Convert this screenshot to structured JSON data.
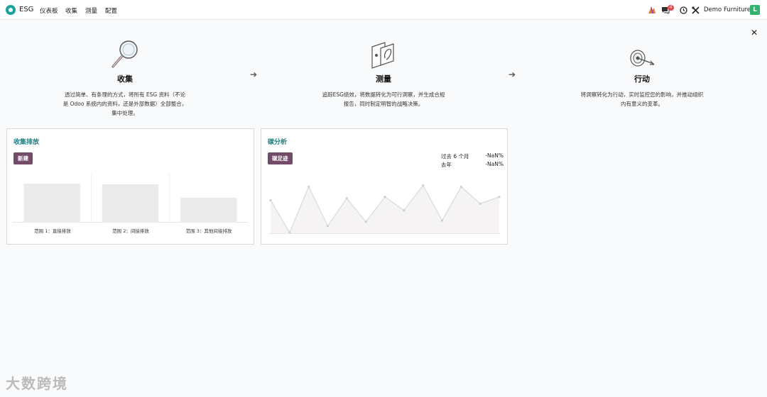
{
  "nav": {
    "app_name": "ESG",
    "menu": [
      "仪表板",
      "收集",
      "测量",
      "配置"
    ],
    "message_count": "4",
    "company": "Demo Furniture",
    "avatar_letter": "L"
  },
  "steps": [
    {
      "title": "收集",
      "desc": "透过简单、有条理的方式，将所有 ESG 资料（不论是 Odoo 系统内的资料，还是外部数据）全部整合，集中处理。",
      "icon": "magnifier-illustration"
    },
    {
      "title": "测量",
      "desc": "追踪ESG绩效，将数据转化为可行洞察，并生成合规报告，同时制定明智的战略决策。",
      "icon": "measure-illustration"
    },
    {
      "title": "行动",
      "desc": "将洞察转化为行动，实时监控您的影响，并推动组织内有意义的变革。",
      "icon": "target-illustration"
    }
  ],
  "emissions_card": {
    "title": "收集排放",
    "button": "新建",
    "chart_data": {
      "type": "bar",
      "categories": [
        "范围 1：直接排放",
        "范围 2：间接排放",
        "范围 3：其他间接排放"
      ],
      "values": [
        55,
        54,
        35
      ],
      "ylim": [
        0,
        68
      ],
      "grid": false
    }
  },
  "carbon_card": {
    "title": "碳分析",
    "button": "碳足迹",
    "stats": [
      {
        "label": "过去 6 个月",
        "value": "-NaN%"
      },
      {
        "label": "去年",
        "value": "-NaN%"
      }
    ],
    "chart_data": {
      "type": "area",
      "values": [
        50,
        2,
        70,
        12,
        53,
        18,
        55,
        35,
        72,
        20,
        70,
        45,
        55
      ],
      "ylim": [
        0,
        80
      ]
    }
  },
  "watermark": "大数跨境",
  "colors": {
    "accent": "#714b67",
    "teal": "#1d7d80",
    "logo": "#1aa39a",
    "badge": "#e34c4c",
    "avatar": "#2fb36d"
  }
}
